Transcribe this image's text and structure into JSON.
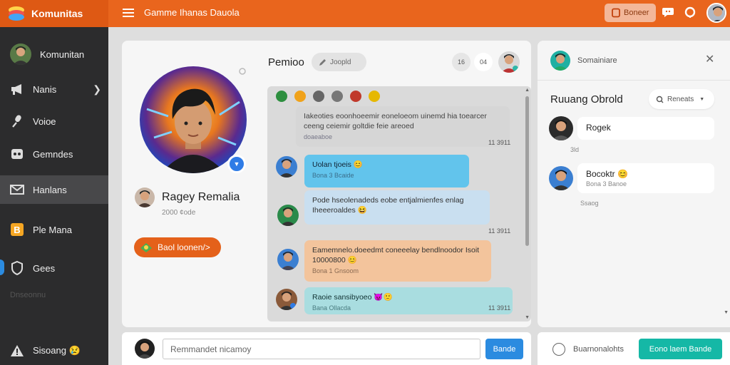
{
  "app": {
    "brand": "Komunitas",
    "page_title": "Gamme Ihanas Dauola"
  },
  "topbar": {
    "notice_label": "Boneer"
  },
  "sidebar": {
    "items": [
      {
        "label": "Komunitan",
        "icon": "avatar"
      },
      {
        "label": "Nanis",
        "icon": "megaphone-icon",
        "has_chevron": true
      },
      {
        "label": "Voioe",
        "icon": "microphone-icon"
      },
      {
        "label": "Gemndes",
        "icon": "gamepad-icon"
      },
      {
        "label": "Hanlans",
        "icon": "mail-icon",
        "active": true
      },
      {
        "label": "Ple Mana",
        "icon": "b-badge-icon"
      },
      {
        "label": "Gees",
        "icon": "shield-icon"
      },
      {
        "label": "Sisoang 😢",
        "icon": "warning-icon"
      }
    ],
    "ghost_text": "Dnseonnu"
  },
  "profile": {
    "name": "Ragey Remalia",
    "meta": "2000 ¢ode",
    "back_label": "Baol loonen/>"
  },
  "chat": {
    "title": "Pemioo",
    "search_label": "Joopld",
    "header_btn_1": "16",
    "header_btn_2": "04",
    "emoji_row": [
      "#2d8f3f",
      "#f0a21a",
      "#666666",
      "#777777",
      "#c0392b",
      "#e6b800"
    ],
    "messages": [
      {
        "text": "Iakeoties eoonhoeemir eoneloeom uinemd hia toearcer ceeng ceiemir goltdie feie areoed",
        "sub": "doaeaboe",
        "time": "11 3911",
        "style": "system"
      },
      {
        "text": "Uolan tjoeis 😊",
        "sub": "Bona 3 Bcaide",
        "style": "blue"
      },
      {
        "text": "Pode hseolenadeds eobe entjalmienfes enlag Iheeeroaldes 😆",
        "time": "11 3911",
        "style": "light"
      },
      {
        "text": "Eamemnelo.doeedmt coneeelay bendlnoodor Isoit 10000800 😊",
        "sub": "Bona 1 Gnsoom",
        "style": "orange"
      },
      {
        "text": "Raoie sansibyoeo 😈🙂",
        "sub": "Bana Ollacda",
        "time": "11 3911",
        "style": "teal"
      }
    ]
  },
  "composer": {
    "placeholder": "Remmandet nicamoy",
    "send_label": "Bande"
  },
  "right_panel": {
    "header": "Somainiare",
    "room_title": "Ruuang Obrold",
    "filter_label": "Reneats",
    "cards": [
      {
        "text": "Rogek",
        "meta": "3ld"
      },
      {
        "text": "Bocoktr 😊",
        "sub": "Bona 3 Banoe",
        "meta": "Ssaog"
      }
    ],
    "footer_text": "Buarnonalohts",
    "footer_button": "Eono laem Bande"
  },
  "colors": {
    "accent": "#e9651d",
    "sidebar": "#2c2c2d",
    "send": "#2b8be0",
    "teal": "#15b8a6"
  }
}
